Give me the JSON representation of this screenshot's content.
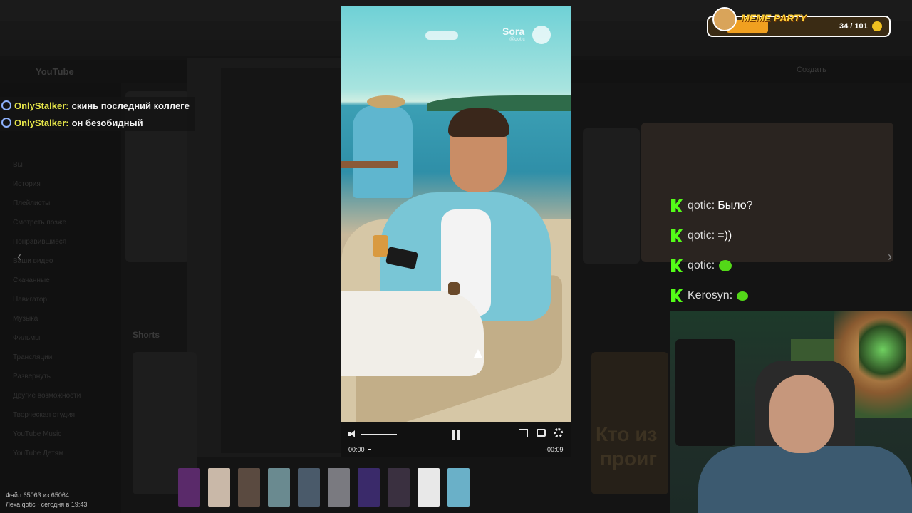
{
  "background": {
    "youtube_logo": "YouTube",
    "create_label": "Создать",
    "sidebar_items": [
      "Вы",
      "История",
      "Плейлисты",
      "Смотреть позже",
      "Понравившиеся",
      "Ваши видео",
      "Скачанные",
      "Навигатор",
      "Музыка",
      "Фильмы",
      "Трансляции",
      "Развернуть",
      "Другие возможности",
      "Творческая студия",
      "YouTube Music",
      "YouTube Детям"
    ],
    "shorts_label": "Shorts",
    "caption_line1": "Кто из",
    "caption_line2": "проиг"
  },
  "chat_top": [
    {
      "user": "OnlyStalker:",
      "message": "скинь последний коллеге"
    },
    {
      "user": "OnlyStalker:",
      "message": "он безобидный"
    }
  ],
  "chat_right": [
    {
      "user": "qotic:",
      "message": "Было?",
      "emote": false
    },
    {
      "user": "qotic:",
      "message": "=))",
      "emote": false
    },
    {
      "user": "qotic:",
      "message": "",
      "emote": true
    },
    {
      "user": "Kerosyn:",
      "message": "",
      "emote": true
    }
  ],
  "meme_party": {
    "title": "MEME PARTY",
    "count": "34 / 101",
    "progress": 0.34
  },
  "player": {
    "watermark": "Sora",
    "watermark_sub": "@qotic",
    "time_current": "00:00",
    "time_remaining": "-00:09"
  },
  "filmstrip_colors": [
    "#5a2a6a",
    "#c9b8a8",
    "#5a4a40",
    "#6a8a90",
    "#4a5a6a",
    "#7a7a80",
    "#3a2a6a",
    "#3a3040",
    "#e8e8e8",
    "#6ab0c8"
  ],
  "file_info": {
    "line1": "Файл 65063 из 65064",
    "line2": "Леха qotic · сегодня в 19:43"
  },
  "colors": {
    "chat_username_top": "#e8e84a",
    "kick_green": "#53fc18",
    "meme_accent": "#ffd23a"
  }
}
